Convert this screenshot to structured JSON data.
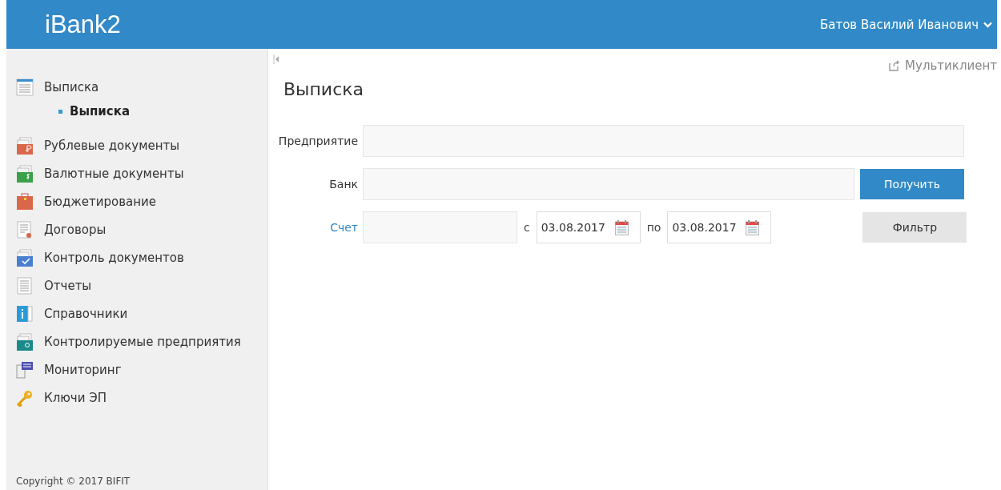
{
  "header": {
    "logo": "iBank2",
    "user": "Батов Василий Иванович"
  },
  "sidebar": {
    "items": [
      {
        "label": "Выписка",
        "kind": "statement",
        "children": [
          {
            "label": "Выписка",
            "selected": true
          }
        ]
      },
      {
        "label": "Рублевые документы",
        "kind": "ruble"
      },
      {
        "label": "Валютные документы",
        "kind": "dollar"
      },
      {
        "label": "Бюджетирование",
        "kind": "case"
      },
      {
        "label": "Договоры",
        "kind": "contract"
      },
      {
        "label": "Контроль документов",
        "kind": "check"
      },
      {
        "label": "Отчеты",
        "kind": "report"
      },
      {
        "label": "Справочники",
        "kind": "info"
      },
      {
        "label": "Контролируемые предприятия",
        "kind": "search"
      },
      {
        "label": "Мониторинг",
        "kind": "monitor"
      },
      {
        "label": "Ключи ЭП",
        "kind": "key"
      }
    ],
    "copyright": "Copyright © 2017 BIFIT"
  },
  "main": {
    "multiclient": "Мультиклиент",
    "title": "Выписка",
    "company": {
      "label": "Предприятие"
    },
    "bank": {
      "label": "Банк"
    },
    "get_button": "Получить",
    "account": {
      "label": "Счет"
    },
    "from": {
      "label": "с",
      "value": "03.08.2017"
    },
    "to": {
      "label": "по",
      "value": "03.08.2017"
    },
    "filter_button": "Фильтр"
  }
}
